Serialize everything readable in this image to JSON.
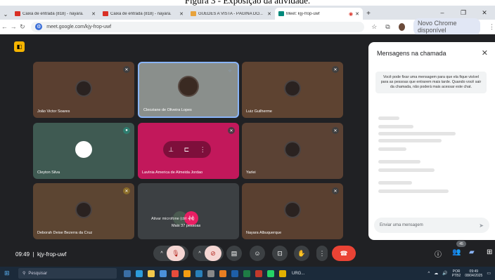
{
  "caption": "Figura 3 - Exposição da atividade.",
  "browser": {
    "tabs": [
      {
        "title": "Caixa de entrada (818) - nayara.",
        "icon": "gmail-icon",
        "color": "#d93025"
      },
      {
        "title": "Caixa de entrada (818) - nayara.",
        "icon": "gmail-icon",
        "color": "#d93025"
      },
      {
        "title": "GUEDES A VISTA - PÁGINA DO...",
        "icon": "site-icon",
        "color": "#e8a33c"
      },
      {
        "title": "Meet: kjy-frop-uwf",
        "icon": "meet-icon",
        "color": "#00897b",
        "active": true
      }
    ],
    "url": "meet.google.com/kjy-frop-uwf",
    "update_label": "Novo Chrome disponível"
  },
  "meet": {
    "participants": [
      {
        "name": "João Victor Soares",
        "bg": "#5a3f30"
      },
      {
        "name": "Cleoziane de Oliveira Lopes",
        "bg": "#8a8f8c"
      },
      {
        "name": "Luiz Guilherme",
        "bg": "#5e4331"
      },
      {
        "name": "Cleyton Silva",
        "bg": "#3f5a52"
      },
      {
        "name": "Lavínia America de Almeida Jordao",
        "bg": "#c2185b"
      },
      {
        "name": "Yarlei",
        "bg": "#5b4234"
      },
      {
        "name": "Deborah Deise Bezerra da Cruz",
        "bg": "#5c4532"
      },
      {
        "name": "Nayara Albuquerque",
        "bg": "#5a4030"
      }
    ],
    "more_label": "Mais 37 pessoas",
    "more_avatar_letter": "H",
    "tooltip": "Ativar microfone (ctrl + d)",
    "time": "09:49",
    "meeting_code": "kjy-frop-uwf",
    "people_count": "45"
  },
  "chat": {
    "title": "Mensagens na chamada",
    "note": "Você pode fixar uma mensagem para que ela fique visível para as pessoas que entrarem mais tarde. Quando você sair da chamada, não poderá mais acessar este chat.",
    "input_placeholder": "Enviar uma mensagem"
  },
  "taskbar": {
    "search_placeholder": "Pesquisar",
    "app_label": "URG...",
    "lang_top": "POR",
    "lang_bottom": "PTB2",
    "time": "09:49",
    "date": "08/04/2025"
  }
}
